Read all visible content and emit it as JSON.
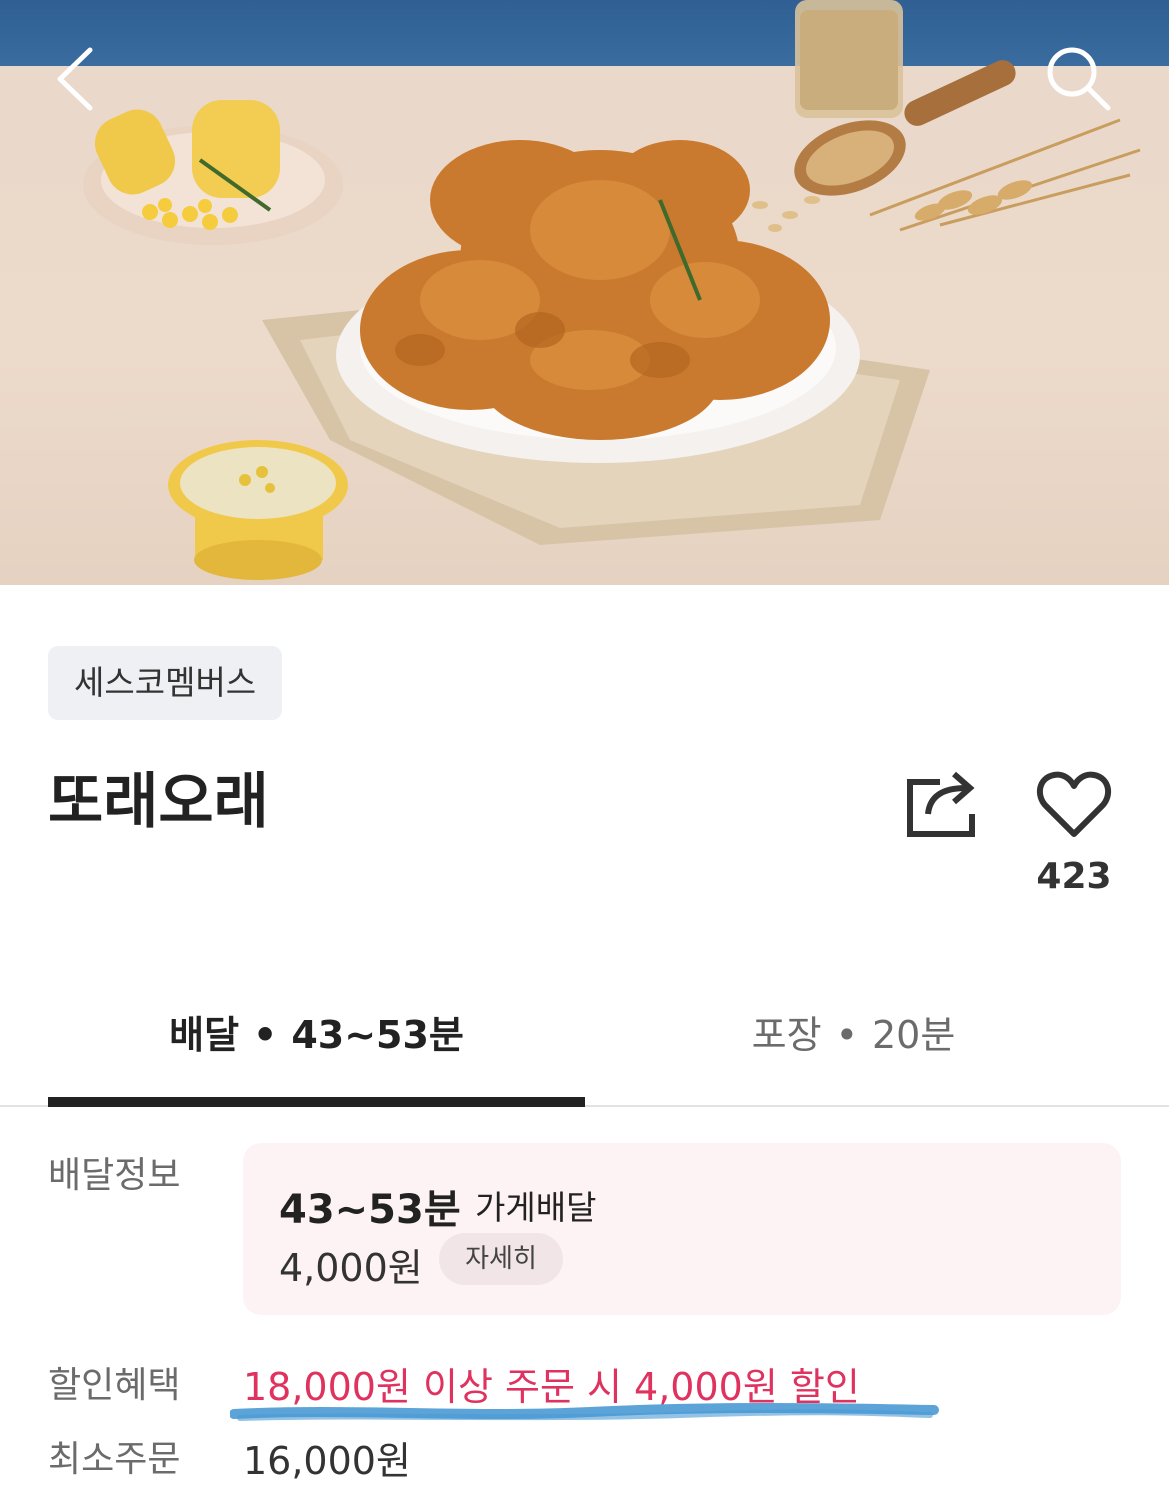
{
  "store": {
    "tag": "세스코멤버스",
    "name": "또래오래",
    "like_count": "423"
  },
  "tabs": {
    "delivery": {
      "label": "배달",
      "dot": "•",
      "time": "43~53분"
    },
    "pickup": {
      "label": "포장",
      "dot": "•",
      "time": "20분"
    }
  },
  "delivery_info": {
    "label": "배달정보",
    "eta": "43~53분",
    "type": "가게배달",
    "fee": "4,000원",
    "detail_button": "자세히"
  },
  "discount": {
    "label": "할인혜택",
    "text": "18,000원 이상 주문 시 4,000원 할인"
  },
  "min_order": {
    "label": "최소주문",
    "value": "16,000원"
  },
  "colors": {
    "discount_red": "#e0325f",
    "card_bg": "#fdf3f4",
    "tab_active": "#222222",
    "highlight_underline": "#4a9ad4"
  },
  "icons": [
    "back-arrow-icon",
    "search-icon",
    "share-icon",
    "heart-icon"
  ]
}
